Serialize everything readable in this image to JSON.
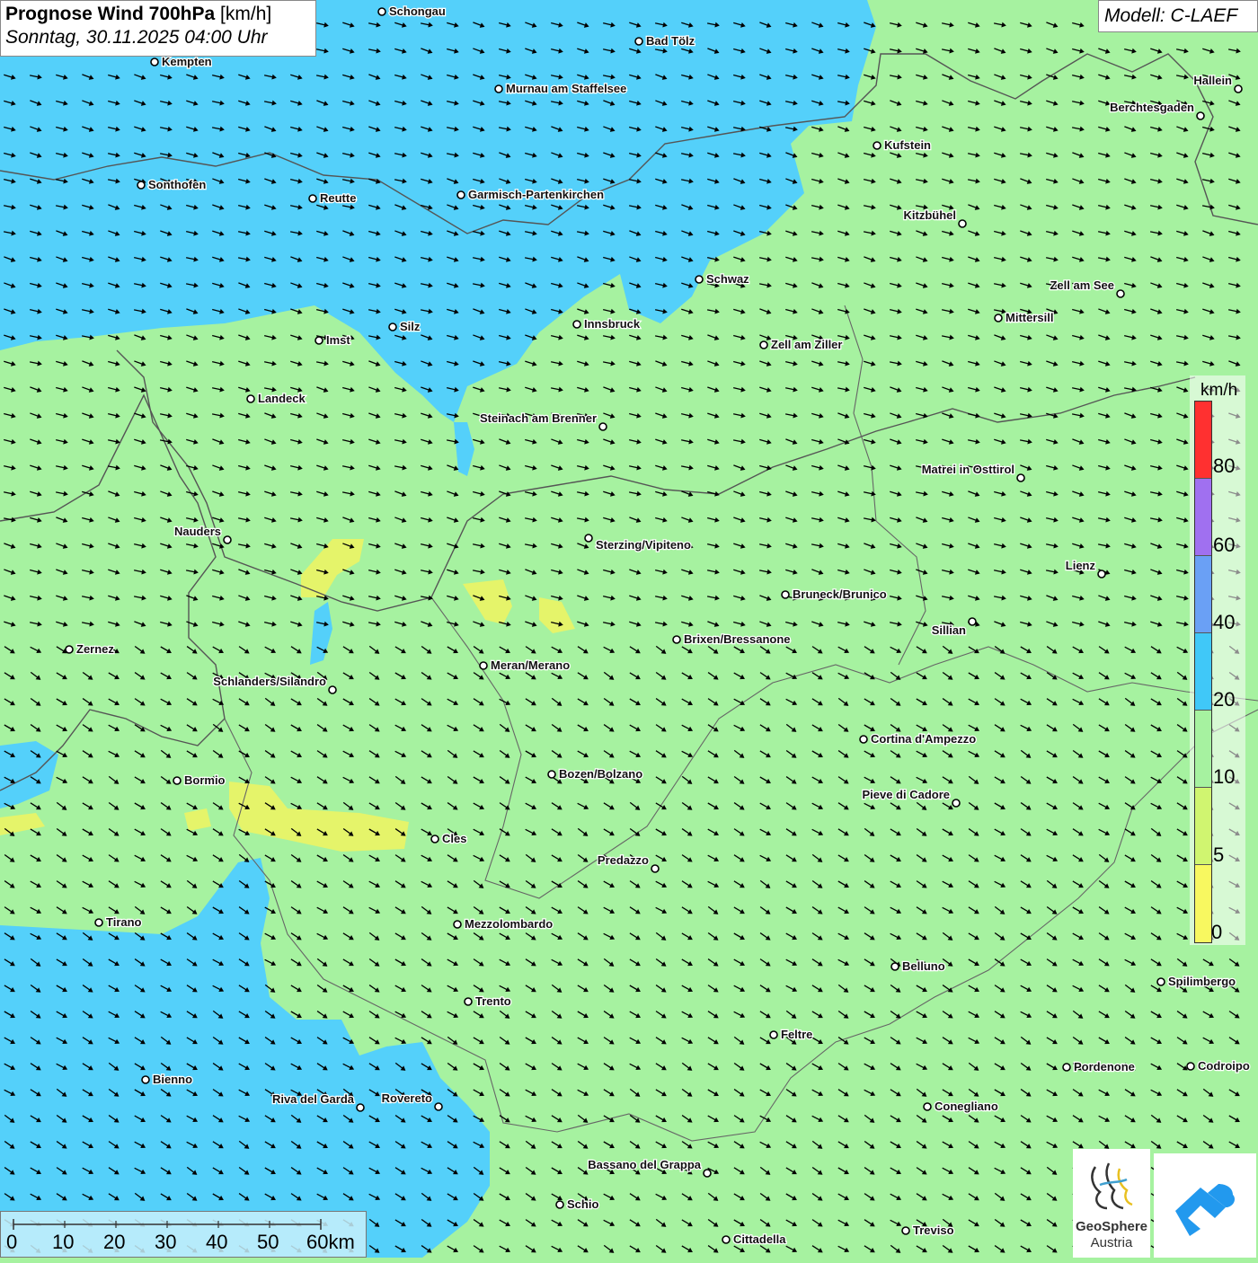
{
  "header": {
    "title_bold": "Prognose Wind 700hPa",
    "title_unit": "[km/h]",
    "datetime": "Sonntag, 30.11.2025 04:00 Uhr"
  },
  "model": {
    "label": "Modell: C-LAEF"
  },
  "legend": {
    "unit": "km/h",
    "ticks": [
      "80",
      "60",
      "40",
      "20",
      "10",
      "5",
      "0"
    ],
    "colors": [
      "#ff3030",
      "#a070f0",
      "#6aa0f5",
      "#40c8f8",
      "#a6f2a0",
      "#d0f570",
      "#f8f860"
    ]
  },
  "palette": {
    "calm": "#f0f560",
    "light": "#a6f2a0",
    "moderate": "#54d0fa",
    "border": "#555555",
    "arrow": "#000000"
  },
  "scale_bar": {
    "labels": [
      "0",
      "10",
      "20",
      "30",
      "40",
      "50",
      "60km"
    ]
  },
  "logos": {
    "geosphere_name": "GeoSphere",
    "geosphere_sub": "Austria",
    "geosphere_icon": "geosphere-logo-icon",
    "app_icon": "warn-app-logo-icon"
  },
  "cities": [
    {
      "name": "Schongau"
    },
    {
      "name": "Bad Tölz"
    },
    {
      "name": "Kempten"
    },
    {
      "name": "Murnau am Staffelsee"
    },
    {
      "name": "Hallein"
    },
    {
      "name": "Berchtesgaden"
    },
    {
      "name": "Kufstein"
    },
    {
      "name": "Sonthofen"
    },
    {
      "name": "Reutte"
    },
    {
      "name": "Garmisch-Partenkirchen"
    },
    {
      "name": "Kitzbühel"
    },
    {
      "name": "Schwaz"
    },
    {
      "name": "Zell am See"
    },
    {
      "name": "Mittersill"
    },
    {
      "name": "Innsbruck"
    },
    {
      "name": "Silz"
    },
    {
      "name": "Imst"
    },
    {
      "name": "Zell am Ziller"
    },
    {
      "name": "Landeck"
    },
    {
      "name": "Steinach am Brenner"
    },
    {
      "name": "Matrei in Osttirol"
    },
    {
      "name": "Nauders"
    },
    {
      "name": "Sterzing/Vipiteno"
    },
    {
      "name": "Lienz"
    },
    {
      "name": "Bruneck/Brunico"
    },
    {
      "name": "Sillian"
    },
    {
      "name": "Brixen/Bressanone"
    },
    {
      "name": "Zernez"
    },
    {
      "name": "Meran/Merano"
    },
    {
      "name": "Schlanders/Silandro"
    },
    {
      "name": "Cortina d'Ampezzo"
    },
    {
      "name": "Bozen/Bolzano"
    },
    {
      "name": "Bormio"
    },
    {
      "name": "Pieve di Cadore"
    },
    {
      "name": "Cles"
    },
    {
      "name": "Predazzo"
    },
    {
      "name": "Tirano"
    },
    {
      "name": "Mezzolombardo"
    },
    {
      "name": "Belluno"
    },
    {
      "name": "Spilimbergo"
    },
    {
      "name": "Trento"
    },
    {
      "name": "Feltre"
    },
    {
      "name": "Pordenone"
    },
    {
      "name": "Codroipo"
    },
    {
      "name": "Bienno"
    },
    {
      "name": "Riva del Garda"
    },
    {
      "name": "Rovereto"
    },
    {
      "name": "Conegliano"
    },
    {
      "name": "Bassano del Grappa"
    },
    {
      "name": "Schio"
    },
    {
      "name": "Treviso"
    },
    {
      "name": "Cittadella"
    }
  ]
}
